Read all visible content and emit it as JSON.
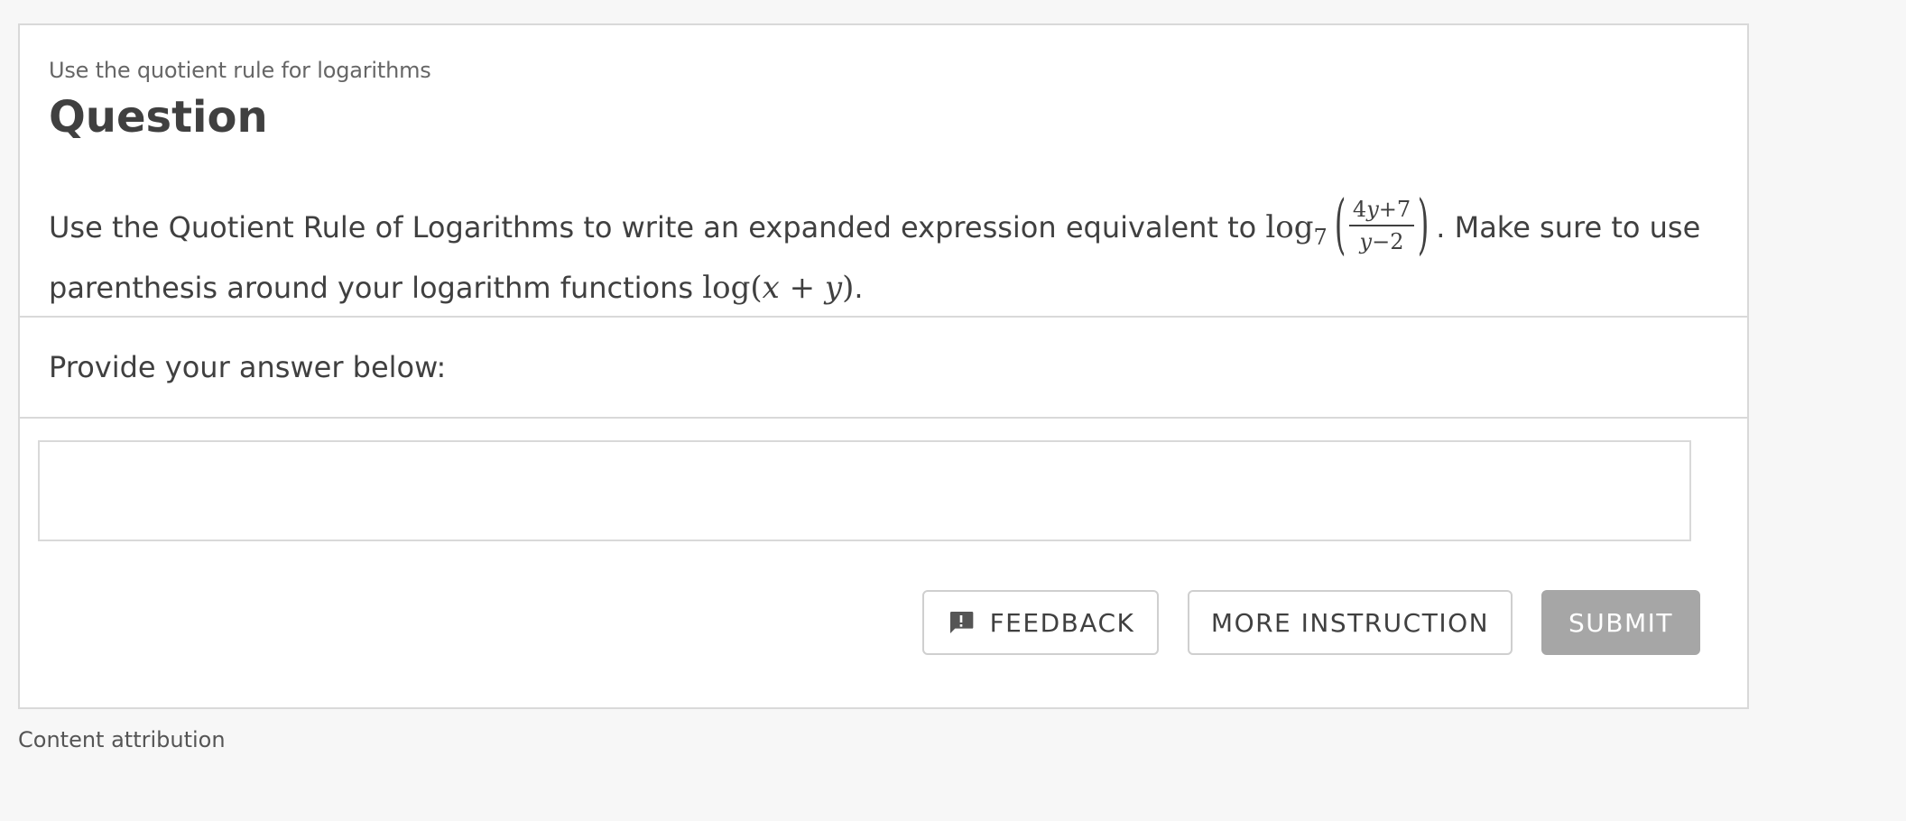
{
  "question": {
    "subtitle": "Use the quotient rule for logarithms",
    "title": "Question",
    "prompt_part1": "Use the Quotient Rule of Logarithms to write an expanded expression equivalent to",
    "math_log_base": "7",
    "math_fraction_numerator": "4y+7",
    "math_fraction_denominator": "y−2",
    "prompt_part2": ". Make sure to use",
    "prompt_line2": "parenthesis around your logarithm functions",
    "math_example": "log(x + y)",
    "prompt_end": "."
  },
  "answer": {
    "label": "Provide your answer below:",
    "value": "",
    "placeholder": ""
  },
  "buttons": {
    "feedback": "FEEDBACK",
    "more_instruction": "MORE INSTRUCTION",
    "submit": "SUBMIT"
  },
  "footer": {
    "attribution": "Content attribution"
  },
  "icons": {
    "feedback": "feedback-bubble-icon"
  },
  "colors": {
    "submit_disabled": "#a6a6a6",
    "text": "#404040",
    "border": "#d9d9d9"
  }
}
